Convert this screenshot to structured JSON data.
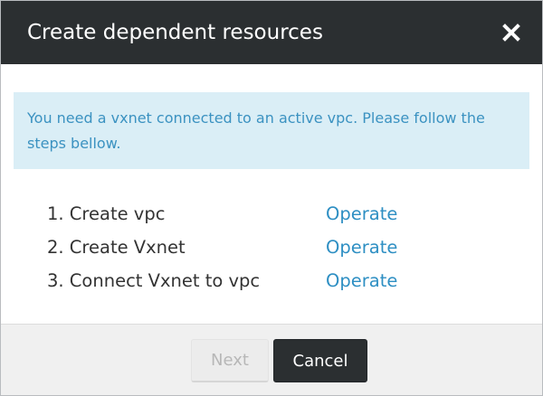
{
  "dialog": {
    "title": "Create dependent resources",
    "close_icon": "close-icon"
  },
  "alert": {
    "message": "You need a vxnet connected to an active vpc. Please follow the steps bellow."
  },
  "steps": [
    {
      "label": "1. Create vpc",
      "action": "Operate"
    },
    {
      "label": "2. Create Vxnet",
      "action": "Operate"
    },
    {
      "label": "3. Connect Vxnet to vpc",
      "action": "Operate"
    }
  ],
  "footer": {
    "next_label": "Next",
    "cancel_label": "Cancel",
    "next_disabled": true
  },
  "colors": {
    "header_bg": "#2b2f31",
    "alert_bg": "#daeef6",
    "alert_text": "#3b92c1",
    "link": "#2e8fc3"
  }
}
